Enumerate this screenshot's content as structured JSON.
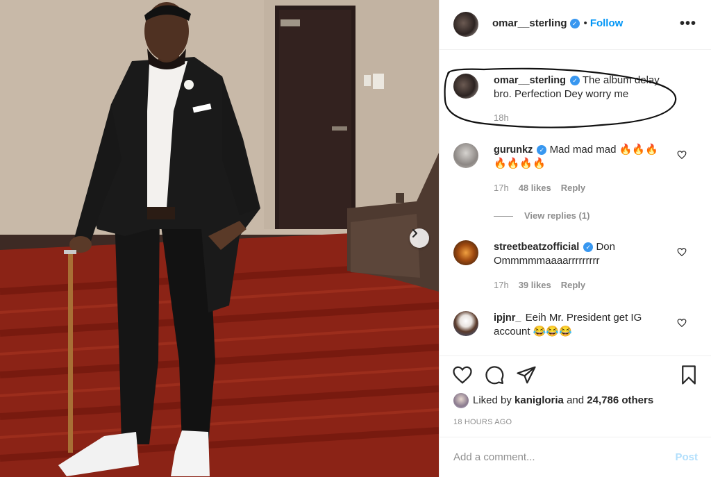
{
  "post": {
    "author": "omar__sterling",
    "follow_label": "Follow",
    "more_label": "•••",
    "verified_icon": "✓"
  },
  "caption": {
    "username": "omar__sterling",
    "text": "The album delay bro. Perfection Dey worry me",
    "time": "18h"
  },
  "comments": [
    {
      "username": "gurunkz",
      "text": "Mad mad mad 🔥🔥🔥🔥🔥🔥🔥",
      "time": "17h",
      "likes": "48 likes",
      "reply": "Reply"
    },
    {
      "username": "streetbeatzofficial",
      "text": "Don Ommmmmaaaarrrrrrrrr",
      "time": "17h",
      "likes": "39 likes",
      "reply": "Reply"
    },
    {
      "username": "ipjnr_",
      "text": "Eeih Mr. President get IG account 😂😂😂"
    }
  ],
  "view_replies_label": "View replies (1)",
  "likes": {
    "prefix": "Liked by",
    "user": "kanigloria",
    "middle": "and",
    "others": "24,786 others"
  },
  "timestamp": "18 HOURS AGO",
  "add_comment": {
    "placeholder": "Add a comment...",
    "post_label": "Post"
  },
  "colors": {
    "accent": "#0095f6",
    "verified": "#3897f0",
    "muted": "#8e8e8e",
    "post_disabled": "#b2dffc"
  },
  "icons": {
    "next": "chevron-right-icon",
    "like": "heart-icon",
    "comment": "comment-icon",
    "share": "paper-plane-icon",
    "save": "bookmark-icon"
  }
}
